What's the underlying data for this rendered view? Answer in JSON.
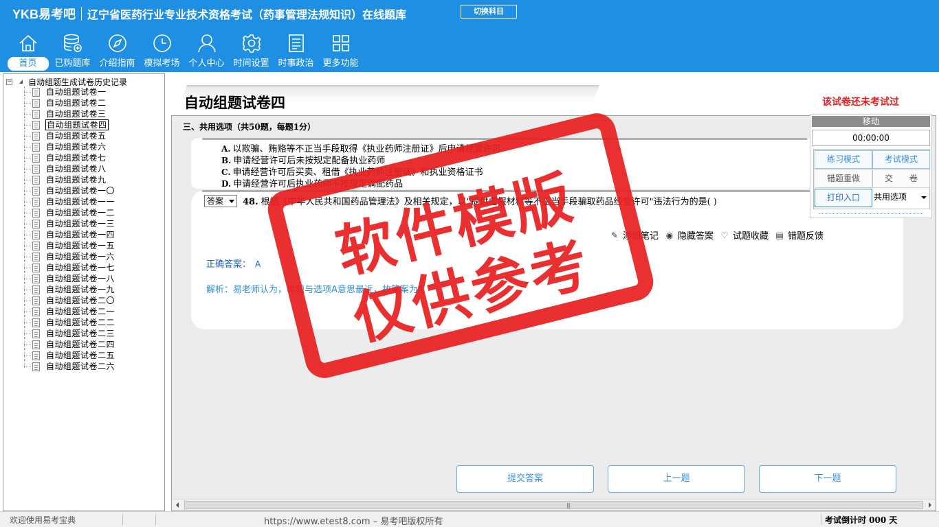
{
  "header": {
    "logo": "YKB易考吧",
    "app_title": "辽宁省医药行业专业技术资格考试（药事管理法规知识）在线题库",
    "switch_subject": "切换科目"
  },
  "toolbar": [
    {
      "label": "首页",
      "icon": "home-icon"
    },
    {
      "label": "已购题库",
      "icon": "database-icon"
    },
    {
      "label": "介绍指南",
      "icon": "compass-icon"
    },
    {
      "label": "模拟考场",
      "icon": "clock-icon"
    },
    {
      "label": "个人中心",
      "icon": "user-icon"
    },
    {
      "label": "时间设置",
      "icon": "gear-icon"
    },
    {
      "label": "时事政治",
      "icon": "news-icon"
    },
    {
      "label": "更多功能",
      "icon": "grid-icon"
    }
  ],
  "tree": {
    "root": "自动组题生成试卷历史记录",
    "items": [
      "自动组题试卷一",
      "自动组题试卷二",
      "自动组题试卷三",
      "自动组题试卷四",
      "自动组题试卷五",
      "自动组题试卷六",
      "自动组题试卷七",
      "自动组题试卷八",
      "自动组题试卷九",
      "自动组题试卷一〇",
      "自动组题试卷一一",
      "自动组题试卷一二",
      "自动组题试卷一三",
      "自动组题试卷一四",
      "自动组题试卷一五",
      "自动组题试卷一六",
      "自动组题试卷一七",
      "自动组题试卷一八",
      "自动组题试卷一九",
      "自动组题试卷二〇",
      "自动组题试卷二一",
      "自动组题试卷二二",
      "自动组题试卷二三",
      "自动组题试卷二四",
      "自动组题试卷二五",
      "自动组题试卷二六"
    ],
    "selected_index": 3
  },
  "paper": {
    "title": "自动组题试卷四",
    "status": "该试卷还未考试过",
    "section": "三、共用选项（共50题，每题1分）"
  },
  "options": [
    {
      "letter": "A.",
      "text": "以欺骗、贿赂等不正当手段取得《执业药师注册证》后申请经营许可"
    },
    {
      "letter": "B.",
      "text": "申请经营许可后未按规定配备执业药师"
    },
    {
      "letter": "C.",
      "text": "申请经营许可后买卖、租借《执业药师注册证》和执业资格证书"
    },
    {
      "letter": "D.",
      "text": "申请经营许可后执业药师不按规定调配药品"
    }
  ],
  "question": {
    "answer_select": "答案",
    "number": "48.",
    "text": "根据《中华人民共和国药品管理法》及相关规定，以\"提供虚假材料等不正当手段骗取药品经营许可\"违法行为的是( )",
    "actions": [
      {
        "label": "添加笔记",
        "icon": "pencil-icon"
      },
      {
        "label": "隐藏答案",
        "icon": "eye-icon"
      },
      {
        "label": "试题收藏",
        "icon": "heart-icon"
      },
      {
        "label": "错题反馈",
        "icon": "feedback-icon"
      }
    ],
    "correct_label": "正确答案：",
    "correct_value": "A",
    "analysis": "解析：易老师认为，本题与选项A意思最近，故答案为A"
  },
  "nav": {
    "submit": "提交答案",
    "prev": "上一题",
    "next": "下一题"
  },
  "control_panel": {
    "move": "移动",
    "timer": "00:00:00",
    "practice_mode": "练习模式",
    "exam_mode": "考试模式",
    "redo_wrong": "错题重做",
    "submit_paper": "交　　卷",
    "print": "打印入口",
    "shared_options": "共用选项"
  },
  "watermark": {
    "line1": "软件模版",
    "line2": "仅供参考"
  },
  "status": {
    "welcome": "欢迎使用易考宝典",
    "url": "https://www.etest8.com – 易考吧版权所有",
    "countdown": "考试倒计时 000 天"
  },
  "colors": {
    "header_bg": "#1f8fe3",
    "accent_blue": "#3a8fd8",
    "alert_red": "#e02020",
    "stamp_red": "#e82020"
  }
}
